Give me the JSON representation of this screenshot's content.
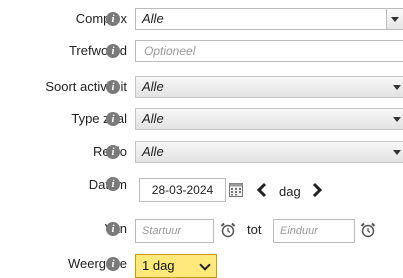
{
  "form": {
    "complex": {
      "label": "Complex",
      "value": "Alle"
    },
    "trefwoord": {
      "label": "Trefwoord",
      "placeholder": "Optioneel"
    },
    "soort_activiteit": {
      "label": "Soort activiteit",
      "value": "Alle"
    },
    "type_zaal": {
      "label": "Type zaal",
      "value": "Alle"
    },
    "regio": {
      "label": "Regio",
      "value": "Alle"
    },
    "datum": {
      "label": "Datum",
      "value": "28-03-2024",
      "unit": "dag"
    },
    "van": {
      "label": "Van",
      "start_placeholder": "Startuur",
      "tot_label": "tot",
      "end_placeholder": "Einduur"
    },
    "weergave": {
      "label": "Weergave",
      "value": "1 dag"
    }
  },
  "info_glyph": "i",
  "colors": {
    "weergave_bg": "#ffe97a",
    "info_icon": "#7a7a7a"
  },
  "icons": [
    "info-icon",
    "calendar-icon",
    "chevron-left-icon",
    "chevron-right-icon",
    "alarm-clock-icon",
    "chevron-down-icon"
  ]
}
